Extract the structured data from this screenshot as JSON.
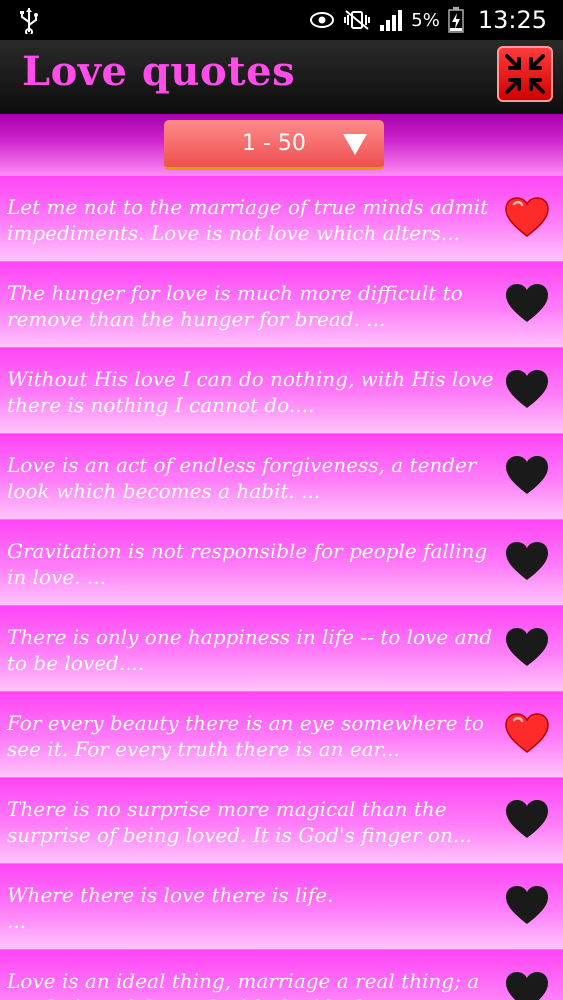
{
  "status_bar": {
    "battery_percent": "5%",
    "time": "13:25"
  },
  "app": {
    "title": "Love quotes"
  },
  "filter": {
    "range_label": "1 - 50"
  },
  "colors": {
    "title_pink": "#ff4dea",
    "row_pink": "#ff44f6",
    "heart_favorite": "#ff2a2a",
    "heart_default": "#1a1a1a"
  },
  "quotes": [
    {
      "text": "Let me not to the marriage of true minds admit\nimpediments. Love is not love which alters...",
      "favorite": true
    },
    {
      "text": "The hunger for love is much more difficult to\nremove than the hunger for bread. ...",
      "favorite": false
    },
    {
      "text": "Without His love I can do nothing, with His love\nthere is nothing I cannot do....",
      "favorite": false
    },
    {
      "text": "Love is an act of endless forgiveness, a tender\nlook which becomes a habit. ...",
      "favorite": false
    },
    {
      "text": "Gravitation is not responsible for people falling\nin love. ...",
      "favorite": false
    },
    {
      "text": "There is only one happiness in life -- to love and\nto be loved....",
      "favorite": false
    },
    {
      "text": "For every beauty there is an eye somewhere to\nsee it. For every truth there is an ear...",
      "favorite": true
    },
    {
      "text": "There is no surprise more magical than the\nsurprise of being loved. It is God's finger on...",
      "favorite": false
    },
    {
      "text": "Where there is love there is life.\n...",
      "favorite": false
    },
    {
      "text": "Love is an ideal thing, marriage a real thing; a\nconfusion of the real with the ideal never...",
      "favorite": false
    }
  ]
}
